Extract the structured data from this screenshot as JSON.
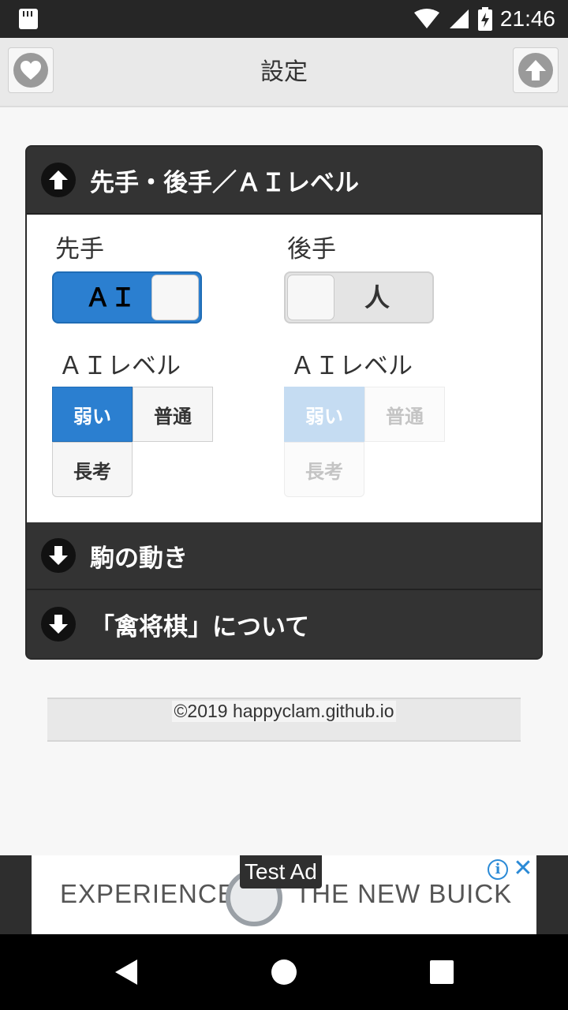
{
  "status_bar": {
    "time": "21:46"
  },
  "header": {
    "title": "設定",
    "left_icon": "heart-icon",
    "right_icon": "arrow-up-icon"
  },
  "sections": [
    {
      "title": "先手・後手／ＡＩレベル",
      "expanded": true
    },
    {
      "title": "駒の動き",
      "expanded": false
    },
    {
      "title": "「禽将棋」について",
      "expanded": false
    }
  ],
  "first_player": {
    "label": "先手",
    "toggle_label": "ＡＩ",
    "toggle_on": true,
    "level_label": "ＡＩレベル",
    "levels": [
      "弱い",
      "普通",
      "長考"
    ],
    "selected_level": "弱い",
    "enabled": true
  },
  "second_player": {
    "label": "後手",
    "toggle_label": "人",
    "toggle_on": false,
    "level_label": "ＡＩレベル",
    "levels": [
      "弱い",
      "普通",
      "長考"
    ],
    "selected_level": "弱い",
    "enabled": false
  },
  "footer": {
    "credit": "©2019 happyclam.github.io"
  },
  "ad": {
    "tag": "Test Ad",
    "left_text": "EXPERIENCE",
    "right_text": "THE NEW BUICK",
    "info": "i",
    "close": "✕"
  },
  "colors": {
    "accent": "#2b7fd0",
    "section_header": "#333333",
    "status_bar": "#262626"
  }
}
